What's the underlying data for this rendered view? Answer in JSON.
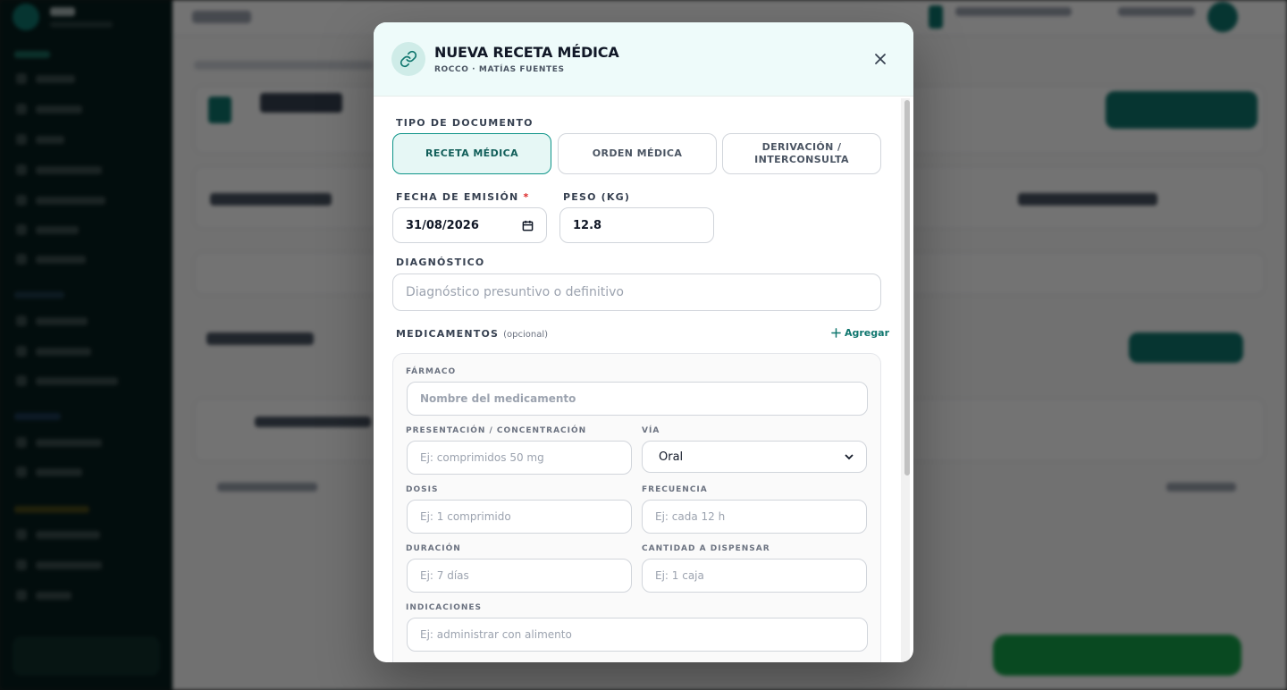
{
  "modal": {
    "title": "NUEVA RECETA MÉDICA",
    "subtitle": "ROCCO · MATÍAS FUENTES",
    "doc_type_label": "TIPO DE DOCUMENTO",
    "doc_types": [
      "RECETA MÉDICA",
      "ORDEN MÉDICA",
      "DERIVACIÓN / INTERCONSULTA"
    ],
    "selected_doc_type": "RECETA MÉDICA",
    "date_label": "FECHA DE EMISIÓN",
    "date_required_mark": "*",
    "date_value": "31/08/2026",
    "weight_label": "PESO (KG)",
    "weight_value": "12.8",
    "diagnosis_label": "DIAGNÓSTICO",
    "diagnosis_placeholder": "Diagnóstico presuntivo o definitivo",
    "meds_label": "MEDICAMENTOS",
    "meds_optional": "(opcional)",
    "add_label": "Agregar",
    "med": {
      "drug_label": "FÁRMACO",
      "drug_placeholder": "Nombre del medicamento",
      "presentation_label": "PRESENTACIÓN / CONCENTRACIÓN",
      "presentation_placeholder": "Ej: comprimidos 50 mg",
      "route_label": "VÍA",
      "route_value": "Oral",
      "dose_label": "DOSIS",
      "dose_placeholder": "Ej: 1 comprimido",
      "frequency_label": "FRECUENCIA",
      "frequency_placeholder": "Ej: cada 12 h",
      "duration_label": "DURACIÓN",
      "duration_placeholder": "Ej: 7 días",
      "quantity_label": "CANTIDAD A DISPENSAR",
      "quantity_placeholder": "Ej: 1 caja",
      "instructions_label": "INDICACIONES",
      "instructions_placeholder": "Ej: administrar con alimento"
    }
  },
  "icons": {
    "header": "link-icon",
    "close": "close-icon",
    "add": "plus-icon",
    "calendar": "calendar-icon",
    "select": "chevron-down-icon"
  },
  "colors": {
    "accent": "#0f766e",
    "active_bg": "#e6f7f5",
    "required": "#dc2626"
  }
}
